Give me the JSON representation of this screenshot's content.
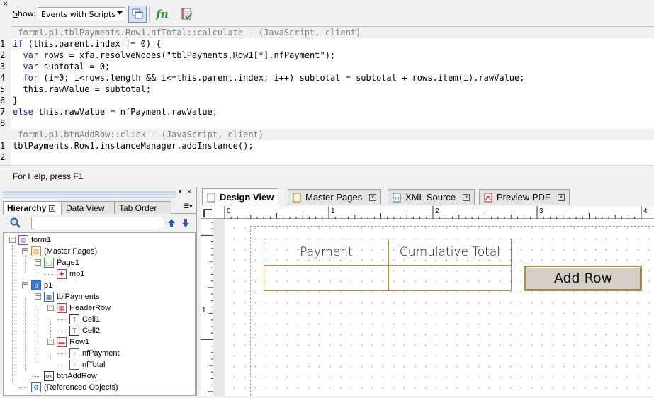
{
  "script_panel": {
    "close_glyph": "×",
    "show_label_prefix": "S",
    "show_label_rest": "how:",
    "show_value": "Events with Scripts",
    "fn_label": "fn",
    "lines": [
      {
        "num": "",
        "header": true,
        "text": " form1.p1.tblPayments.Row1.nfTotal::calculate - (JavaScript, client)"
      },
      {
        "num": "1",
        "header": false,
        "text": "if (this.parent.index != 0) {"
      },
      {
        "num": "2",
        "header": false,
        "text": "  var rows = xfa.resolveNodes(\"tblPayments.Row1[*].nfPayment\");"
      },
      {
        "num": "3",
        "header": false,
        "text": "  var subtotal = 0;"
      },
      {
        "num": "4",
        "header": false,
        "text": "  for (i=0; i<rows.length && i<=this.parent.index; i++) subtotal = subtotal + rows.item(i).rawValue;"
      },
      {
        "num": "5",
        "header": false,
        "text": "  this.rawValue = subtotal;"
      },
      {
        "num": "6",
        "header": false,
        "text": "}"
      },
      {
        "num": "7",
        "header": false,
        "text": "else this.rawValue = nfPayment.rawValue;"
      },
      {
        "num": "8",
        "header": false,
        "text": ""
      },
      {
        "num": "",
        "header": true,
        "text": " form1.p1.btnAddRow::click - (JavaScript, client)"
      },
      {
        "num": "1",
        "header": false,
        "text": "tblPayments.Row1.instanceManager.addInstance();"
      },
      {
        "num": "2",
        "header": false,
        "text": ""
      }
    ],
    "help_text": "For Help, press F1"
  },
  "hierarchy_panel": {
    "title_controls": "▾ ×",
    "tabs": [
      {
        "label": "Hierarchy",
        "active": true
      },
      {
        "label": "Data View",
        "active": false
      },
      {
        "label": "Tab Order",
        "active": false
      }
    ],
    "tree": [
      {
        "label": "form1",
        "depth": 0,
        "icon": "form-icon",
        "expander": "−"
      },
      {
        "label": "(Master Pages)",
        "depth": 1,
        "icon": "master-pages-icon",
        "expander": "−"
      },
      {
        "label": "Page1",
        "depth": 2,
        "icon": "page-icon",
        "expander": "−"
      },
      {
        "label": "mp1",
        "depth": 3,
        "icon": "content-area-icon",
        "expander": ""
      },
      {
        "label": "p1",
        "depth": 1,
        "icon": "subform-icon",
        "expander": "−",
        "selected": true
      },
      {
        "label": "tblPayments",
        "depth": 2,
        "icon": "table-icon",
        "expander": "−"
      },
      {
        "label": "HeaderRow",
        "depth": 3,
        "icon": "header-row-icon",
        "expander": "−"
      },
      {
        "label": "Cell1",
        "depth": 4,
        "icon": "text-icon",
        "expander": ""
      },
      {
        "label": "Cell2",
        "depth": 4,
        "icon": "text-icon",
        "expander": ""
      },
      {
        "label": "Row1",
        "depth": 3,
        "icon": "row-icon",
        "expander": "−"
      },
      {
        "label": "nfPayment",
        "depth": 4,
        "icon": "numeric-field-icon",
        "expander": ""
      },
      {
        "label": "nfTotal",
        "depth": 4,
        "icon": "numeric-field-icon",
        "expander": ""
      },
      {
        "label": "btnAddRow",
        "depth": 2,
        "icon": "button-icon",
        "expander": ""
      },
      {
        "label": "(Referenced Objects)",
        "depth": 1,
        "icon": "referenced-objects-icon",
        "expander": ""
      }
    ]
  },
  "design_area": {
    "tabs": [
      {
        "label": "Design View",
        "active": true,
        "icon": "design-view-icon"
      },
      {
        "label": "Master Pages",
        "active": false,
        "icon": "master-pages-icon"
      },
      {
        "label": "XML Source",
        "active": false,
        "icon": "xml-source-icon"
      },
      {
        "label": "Preview PDF",
        "active": false,
        "icon": "pdf-icon"
      }
    ],
    "ruler_top_labels": [
      "0",
      "1",
      "2",
      "3",
      "4"
    ],
    "ruler_left_labels": [
      "1"
    ],
    "table_headers": [
      "Payment",
      "Cumulative Total"
    ],
    "add_row_label": "Add Row"
  },
  "colors": {
    "keyword": "#1a1aa6",
    "table_border": "#c8863a",
    "selection": "#6a80c8"
  }
}
